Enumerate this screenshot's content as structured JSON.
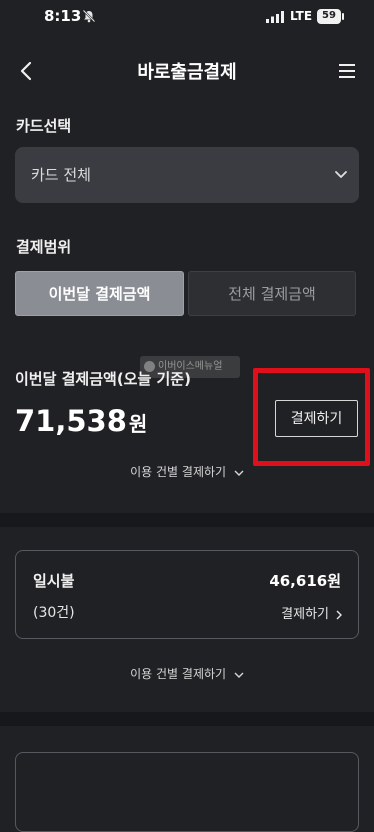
{
  "status_bar": {
    "time": "8:13",
    "network": "LTE",
    "battery": "59"
  },
  "header": {
    "title": "바로출금결제"
  },
  "card_select": {
    "label": "카드선택",
    "value": "카드 전체"
  },
  "payment_range": {
    "label": "결제범위",
    "options": [
      "이번달 결제금액",
      "전체 결제금액"
    ],
    "selected": "이번달 결제금액"
  },
  "amount": {
    "label": "이번달 결제금액(오늘 기준)",
    "value": "71,538",
    "unit": "원",
    "pay_button": "결제하기",
    "itemized_link": "이용 건별 결제하기"
  },
  "watermark": {
    "text": "이버이스메뉴얼"
  },
  "installment": {
    "title": "일시불",
    "count": "(30건)",
    "amount": "46,616원",
    "pay_link": "결제하기",
    "itemized_link": "이용 건별 결제하기"
  },
  "colors": {
    "highlight": "#e0101a",
    "background": "#202124"
  }
}
